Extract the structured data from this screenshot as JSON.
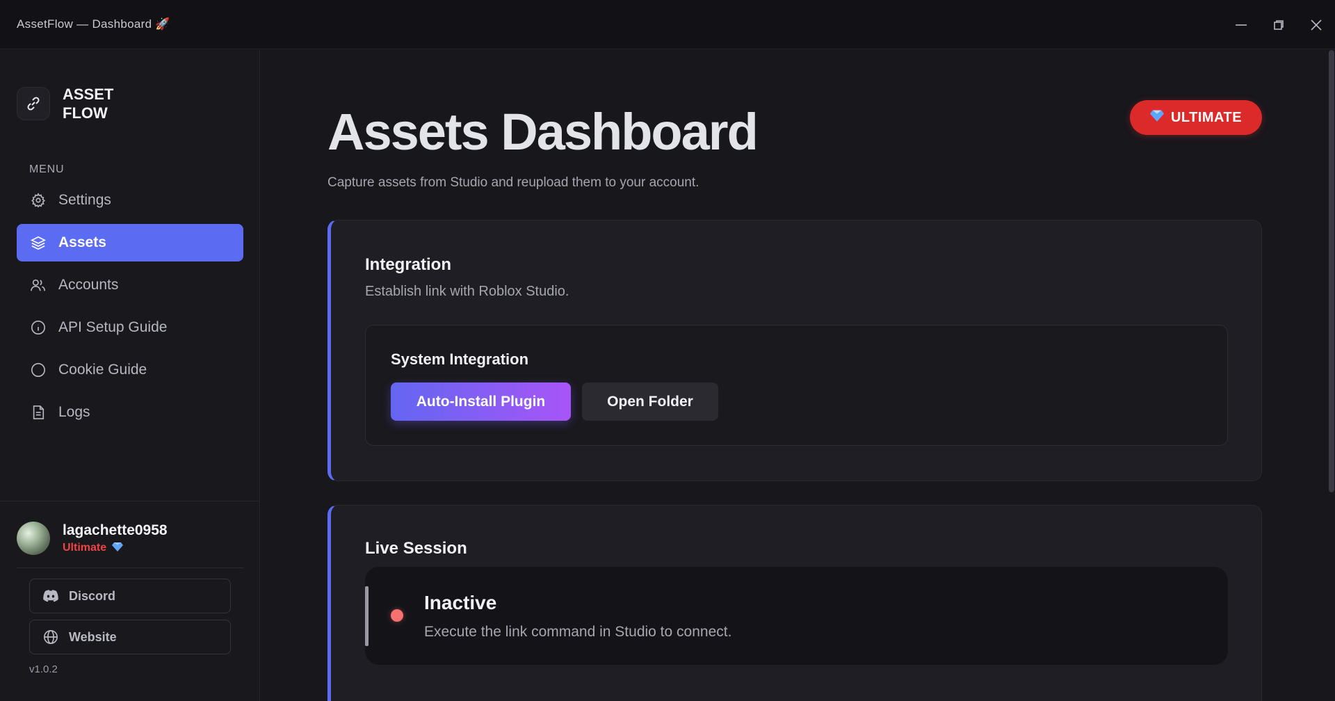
{
  "window": {
    "title": "AssetFlow — Dashboard 🚀"
  },
  "sidebar": {
    "brand": {
      "name": "ASSET FLOW",
      "logo_icon": "link-icon"
    },
    "menu_label": "MENU",
    "items": [
      {
        "label": "Settings",
        "icon": "gear-icon",
        "active": false
      },
      {
        "label": "Assets",
        "icon": "layers-icon",
        "active": true
      },
      {
        "label": "Accounts",
        "icon": "users-icon",
        "active": false
      },
      {
        "label": "API Setup Guide",
        "icon": "info-icon",
        "active": false
      },
      {
        "label": "Cookie Guide",
        "icon": "circle-icon",
        "active": false
      },
      {
        "label": "Logs",
        "icon": "document-icon",
        "active": false
      }
    ],
    "user": {
      "name": "lagachette0958",
      "tier": "Ultimate",
      "tier_color": "#ef4444"
    },
    "links": [
      {
        "label": "Discord",
        "icon": "discord-icon"
      },
      {
        "label": "Website",
        "icon": "globe-icon"
      }
    ],
    "version": "v1.0.2"
  },
  "main": {
    "title": "Assets Dashboard",
    "subtitle": "Capture assets from Studio and reupload them to your account.",
    "badge": {
      "label": "ULTIMATE",
      "color": "#dc2a2a"
    },
    "integration": {
      "title": "Integration",
      "description": "Establish link with Roblox Studio.",
      "system": {
        "title": "System Integration",
        "primary_button": "Auto-Install Plugin",
        "secondary_button": "Open Folder"
      }
    },
    "live_session": {
      "title": "Live Session",
      "status": "Inactive",
      "status_color": "#f87171",
      "description": "Execute the link command in Studio to connect."
    }
  },
  "colors": {
    "accent": "#5b6cf2",
    "background": "#17171c",
    "sidebar": "#18181d"
  }
}
